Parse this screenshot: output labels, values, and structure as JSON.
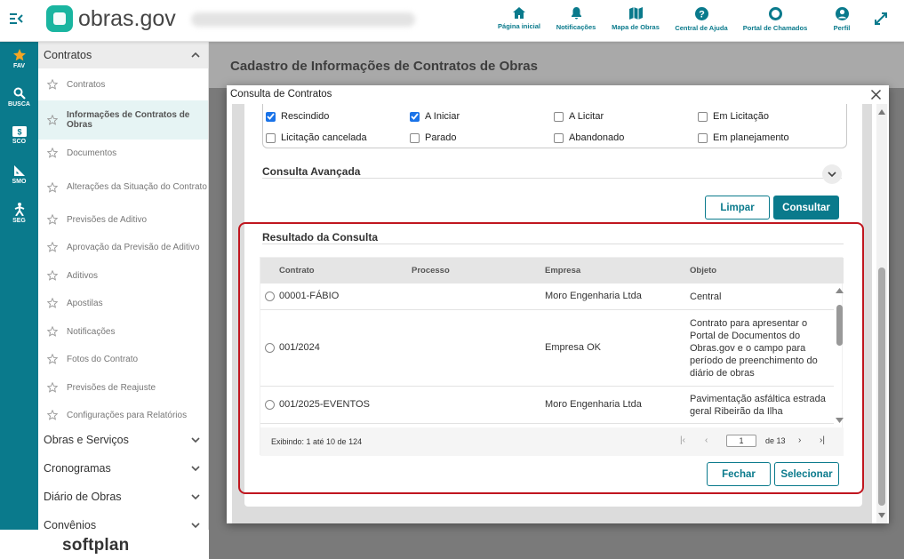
{
  "app": {
    "logo_text": "obras.gov",
    "title_blurred": "SI Sistema de Homologação"
  },
  "topnav": [
    {
      "label": "Página inicial",
      "icon": "home-icon"
    },
    {
      "label": "Notificações",
      "icon": "bell-icon"
    },
    {
      "label": "Mapa de Obras",
      "icon": "map-icon"
    },
    {
      "label": "Central de Ajuda",
      "icon": "help-icon"
    },
    {
      "label": "Portal de Chamados",
      "icon": "lifebuoy-icon"
    },
    {
      "label": "Perfil",
      "icon": "user-icon"
    }
  ],
  "rail": [
    {
      "label": "FAV",
      "icon": "star-icon"
    },
    {
      "label": "BUSCA",
      "icon": "search-icon"
    },
    {
      "label": "SCO",
      "icon": "money-icon"
    },
    {
      "label": "SMO",
      "icon": "ruler-icon"
    },
    {
      "label": "SEG",
      "icon": "person-icon"
    }
  ],
  "sidebar": {
    "open_section": "Contratos",
    "items": [
      "Contratos",
      "Informações de Contratos de Obras",
      "Documentos",
      "Alterações da Situação do Contrato",
      "Previsões de Aditivo",
      "Aprovação da Previsão de Aditivo",
      "Aditivos",
      "Apostilas",
      "Notificações",
      "Fotos do Contrato",
      "Previsões de Reajuste",
      "Configurações para Relatórios"
    ],
    "active_item": "Informações de Contratos de Obras",
    "sections": [
      "Obras e Serviços",
      "Cronogramas",
      "Diário de Obras",
      "Convênios"
    ]
  },
  "brand": "softplan",
  "page": {
    "title": "Cadastro de Informações de Contratos de Obras"
  },
  "modal": {
    "title": "Consulta de Contratos",
    "statuses": [
      {
        "label": "Rescindido",
        "checked": true
      },
      {
        "label": "A Iniciar",
        "checked": true
      },
      {
        "label": "A Licitar",
        "checked": false
      },
      {
        "label": "Em Licitação",
        "checked": false
      },
      {
        "label": "Licitação cancelada",
        "checked": false
      },
      {
        "label": "Parado",
        "checked": false
      },
      {
        "label": "Abandonado",
        "checked": false
      },
      {
        "label": "Em planejamento",
        "checked": false
      }
    ],
    "advanced_title": "Consulta Avançada",
    "clear_label": "Limpar",
    "search_label": "Consultar",
    "results_title": "Resultado da Consulta",
    "columns": [
      "Contrato",
      "Processo",
      "Empresa",
      "Objeto"
    ],
    "rows": [
      {
        "contrato": "00001-FÁBIO",
        "processo": "",
        "empresa": "Moro Engenharia Ltda",
        "objeto": [
          "Central"
        ]
      },
      {
        "contrato": "001/2024",
        "processo": "",
        "empresa": "Empresa OK",
        "objeto": [
          "Contrato para apresentar o",
          "Portal de Documentos do",
          "Obras.gov e o campo para",
          "período de preenchimento do",
          "diário de obras"
        ]
      },
      {
        "contrato": "001/2025-EVENTOS",
        "processo": "",
        "empresa": "Moro Engenharia Ltda",
        "objeto": [
          "Pavimentação asfáltica estrada",
          "geral Ribeirão da Ilha"
        ]
      }
    ],
    "pagination": {
      "showing": "Exibindo: 1 até 10 de 124",
      "page": "1",
      "of": "de 13"
    },
    "close_label": "Fechar",
    "select_label": "Selecionar"
  },
  "colors": {
    "primary": "#0a7a8c",
    "highlight": "#c0161f",
    "logo": "#1ab5a0"
  }
}
